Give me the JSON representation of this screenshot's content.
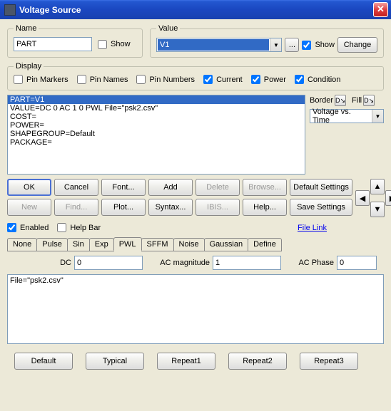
{
  "window": {
    "title": "Voltage Source"
  },
  "name_group": {
    "legend": "Name",
    "value": "PART",
    "show_label": "Show",
    "show_checked": false
  },
  "value_group": {
    "legend": "Value",
    "value": "V1",
    "ellipsis": "...",
    "show_label": "Show",
    "show_checked": true,
    "change_label": "Change"
  },
  "display_group": {
    "legend": "Display",
    "items": [
      {
        "label": "Pin Markers",
        "checked": false
      },
      {
        "label": "Pin Names",
        "checked": false
      },
      {
        "label": "Pin Numbers",
        "checked": false
      },
      {
        "label": "Current",
        "checked": true
      },
      {
        "label": "Power",
        "checked": true
      },
      {
        "label": "Condition",
        "checked": true
      }
    ]
  },
  "listing": {
    "lines": [
      "PART=V1",
      "VALUE=DC 0 AC 1 0 PWL File=\"psk2.csv\"",
      "COST=",
      "POWER=",
      "SHAPEGROUP=Default",
      "PACKAGE="
    ],
    "selected_index": 0
  },
  "side": {
    "border_label": "Border",
    "fill_label": "Fill",
    "dropdown_value": "Voltage vs. Time"
  },
  "buttons_row1": [
    "OK",
    "Cancel",
    "Font...",
    "Add",
    "Delete",
    "Browse...",
    "Default Settings"
  ],
  "buttons_row1_disabled": [
    false,
    false,
    false,
    false,
    true,
    true,
    false
  ],
  "buttons_row2": [
    "New",
    "Find...",
    "Plot...",
    "Syntax...",
    "IBIS...",
    "Help...",
    "Save Settings"
  ],
  "buttons_row2_disabled": [
    true,
    true,
    false,
    false,
    true,
    false,
    false
  ],
  "enable_row": {
    "enabled_label": "Enabled",
    "enabled_checked": true,
    "helpbar_label": "Help Bar",
    "helpbar_checked": false,
    "filelink_label": "File Link"
  },
  "tabs": [
    "None",
    "Pulse",
    "Sin",
    "Exp",
    "PWL",
    "SFFM",
    "Noise",
    "Gaussian",
    "Define"
  ],
  "active_tab_index": 4,
  "params": {
    "dc_label": "DC",
    "dc_value": "0",
    "acmag_label": "AC magnitude",
    "acmag_value": "1",
    "acphase_label": "AC Phase",
    "acphase_value": "0"
  },
  "file_content": "File=\"psk2.csv\"",
  "bottom_buttons": [
    "Default",
    "Typical",
    "Repeat1",
    "Repeat2",
    "Repeat3"
  ]
}
